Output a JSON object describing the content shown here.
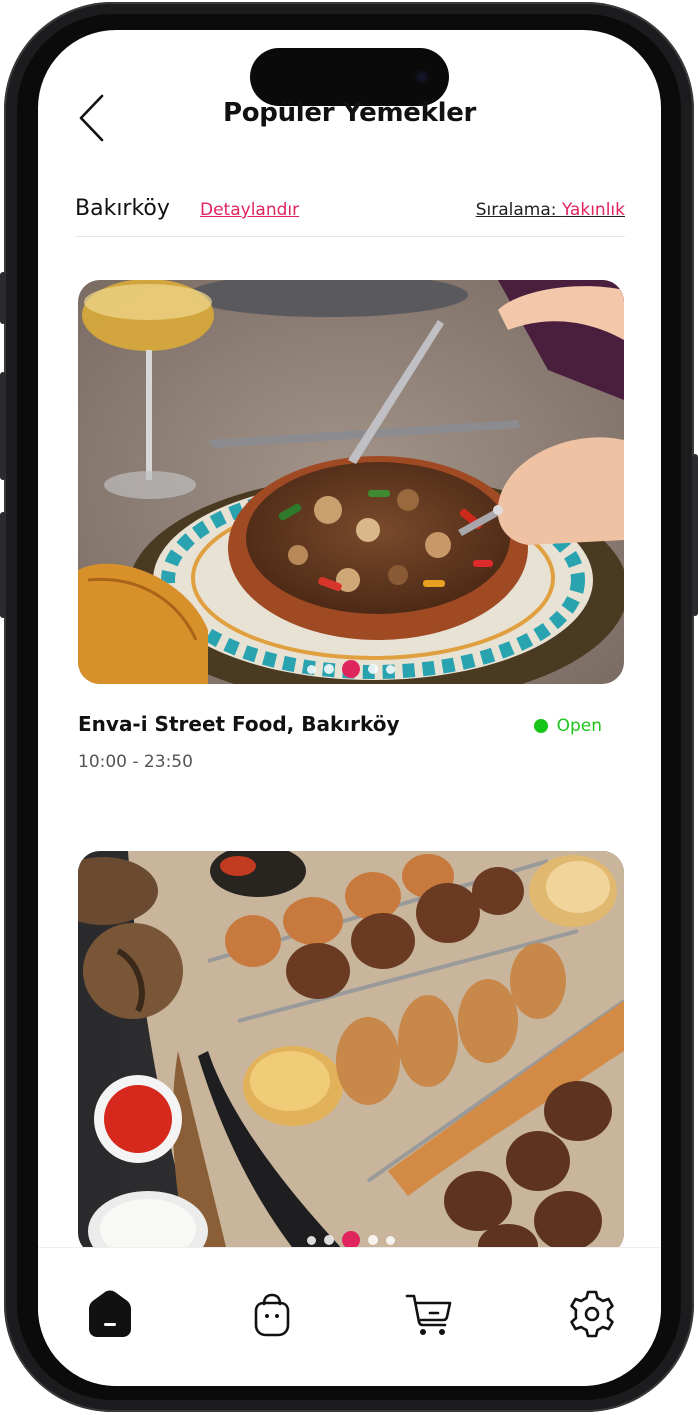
{
  "header": {
    "title": "Popüler Yemekler",
    "back_icon": "chevron-left-icon"
  },
  "filter": {
    "location": "Bakırköy",
    "detail_link": "Detaylandır",
    "sort_label": "Sıralama:",
    "sort_value": "Yakınlık"
  },
  "restaurants": [
    {
      "name": "Enva-i Street Food, Bakırköy",
      "hours": "10:00 - 23:50",
      "status": "Open",
      "status_color": "#18c418",
      "image": "clay-pot-meat-stew-photo",
      "carousel_count": 5,
      "carousel_active": 3
    },
    {
      "image": "mixed-grill-kebab-platter-photo",
      "carousel_count": 5,
      "carousel_active": 3
    }
  ],
  "tabbar": {
    "items": [
      "home-icon",
      "bag-icon",
      "cart-icon",
      "settings-icon"
    ],
    "active": 0
  },
  "colors": {
    "accent": "#e0245e",
    "open": "#18c418"
  }
}
